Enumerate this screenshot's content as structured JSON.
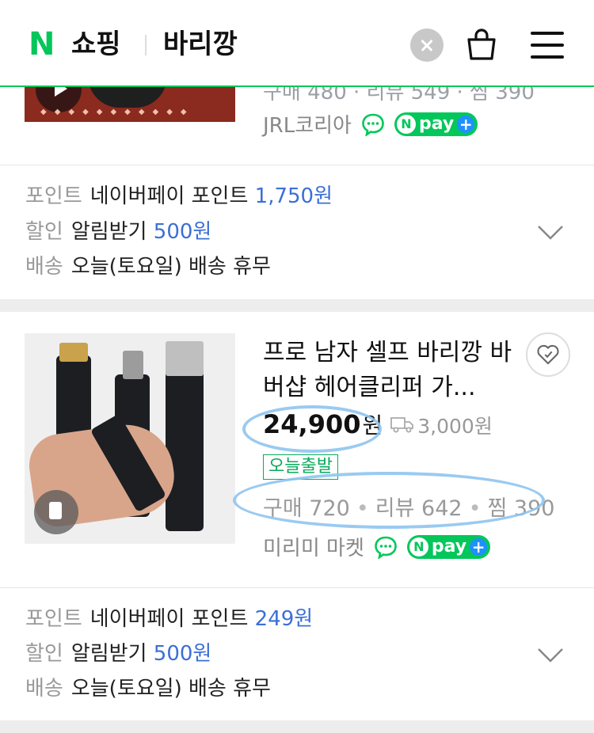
{
  "header": {
    "logo": "N",
    "service": "쇼핑",
    "search_query": "바리깡"
  },
  "product_prev": {
    "cut_stats_text": "구매 480 · 리뷰 549 · 찜 390",
    "seller": "JRL코리아",
    "npay_label": "pay"
  },
  "benefits_prev": {
    "point_label": "포인트",
    "point_text": "네이버페이 포인트",
    "point_value": "1,750원",
    "discount_label": "할인",
    "discount_text": "알림받기",
    "discount_value": "500원",
    "delivery_label": "배송",
    "delivery_text": "오늘(토요일) 배송 휴무"
  },
  "product": {
    "title": "프로 남자 셀프 바리깡 바버샵 헤어클리퍼 가...",
    "price": "24,900",
    "price_unit": "원",
    "shipping_fee": "3,000원",
    "badge": "오늘출발",
    "stats": {
      "purchase": "구매 720",
      "review": "리뷰 642",
      "wish": "찜 390"
    },
    "seller": "미리미 마켓",
    "npay_label": "pay"
  },
  "benefits": {
    "point_label": "포인트",
    "point_text": "네이버페이 포인트",
    "point_value": "249원",
    "discount_label": "할인",
    "discount_text": "알림받기",
    "discount_value": "500원",
    "delivery_label": "배송",
    "delivery_text": "오늘(토요일) 배송 휴무"
  },
  "colors": {
    "naver_green": "#03c75a",
    "link_blue": "#3b6fd6",
    "annotation": "#8fc4ef"
  }
}
